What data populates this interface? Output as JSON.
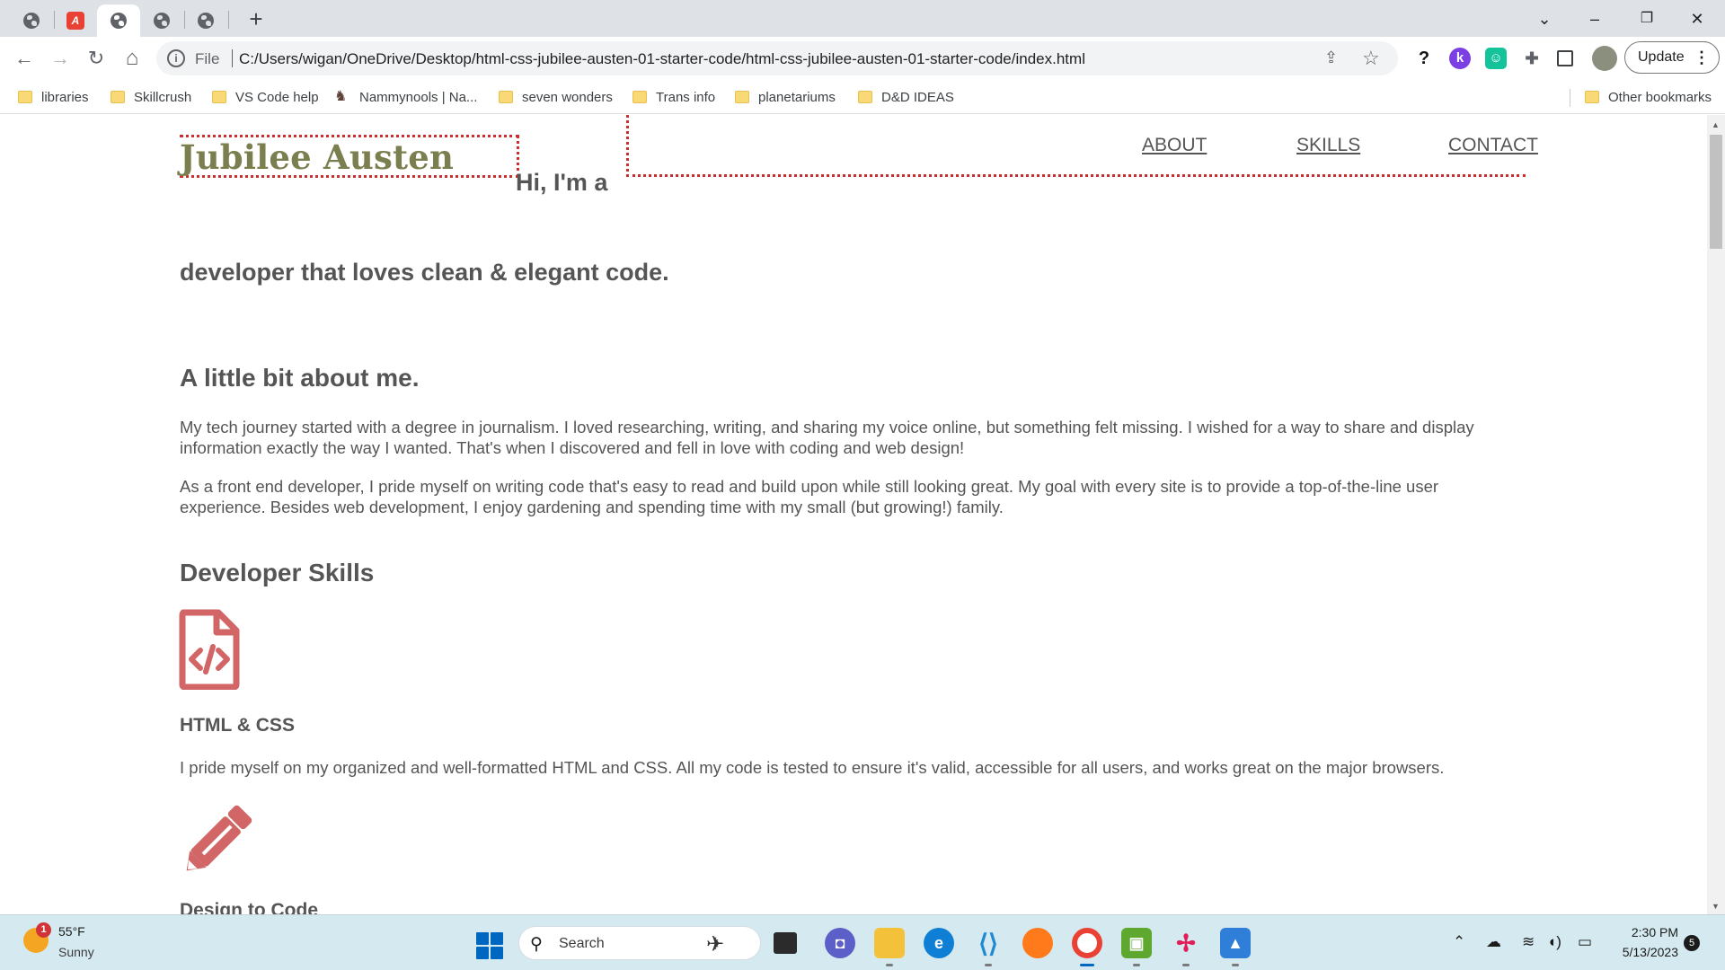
{
  "browser": {
    "tabs": [
      {
        "icon": "globe-icon"
      },
      {
        "icon": "pdf-icon"
      },
      {
        "icon": "globe-icon",
        "active": true
      },
      {
        "icon": "globe-icon"
      },
      {
        "icon": "globe-icon"
      }
    ],
    "new_tab": "+",
    "window_controls": {
      "minimize": "–",
      "restore": "❐",
      "close": "✕",
      "tab_search": "⌄"
    },
    "nav": {
      "back": "←",
      "forward": "→",
      "reload": "↻",
      "home": "⌂"
    },
    "address": {
      "scheme": "File",
      "url": "C:/Users/wigan/OneDrive/Desktop/html-css-jubilee-austen-01-starter-code/html-css-jubilee-austen-01-starter-code/index.html"
    },
    "update_label": "Update",
    "bookmarks": [
      "libraries",
      "Skillcrush",
      "VS Code help",
      "Nammynools | Na...",
      "seven wonders",
      "Trans info",
      "planetariums",
      "D&D IDEAS"
    ],
    "other_bookmarks": "Other bookmarks"
  },
  "site": {
    "logo": "Jubilee Austen",
    "nav": [
      "ABOUT",
      "SKILLS",
      "CONTACT"
    ],
    "hero_intro": "Hi, I'm a",
    "hero_tagline": "developer that loves clean & elegant code.",
    "about": {
      "heading": "A little bit about me.",
      "paragraphs": [
        "My tech journey started with a degree in journalism. I loved researching, writing, and sharing my voice online, but something felt missing. I wished for a way to share and display information exactly the way I wanted. That's when I discovered and fell in love with coding and web design!",
        "As a front end developer, I pride myself on writing code that's easy to read and build upon while still looking great. My goal with every site is to provide a top-of-the-line user experience. Besides web development, I enjoy gardening and spending time with my small (but growing!) family."
      ]
    },
    "skills": {
      "heading": "Developer Skills",
      "items": [
        {
          "icon": "code-file-icon",
          "title": "HTML & CSS",
          "desc": "I pride myself on my organized and well-formatted HTML and CSS. All my code is tested to ensure it's valid, accessible for all users, and works great on the major browsers."
        },
        {
          "icon": "pencil-icon",
          "title": "Design to Code"
        }
      ]
    },
    "accent_color": "#cc2d2d",
    "icon_color": "#d26565",
    "logo_color": "#7b7f4f"
  },
  "taskbar": {
    "weather": {
      "temp": "55°F",
      "condition": "Sunny",
      "alerts": "1"
    },
    "search_label": "Search",
    "time": "2:30 PM",
    "date": "5/13/2023",
    "notifications": "5"
  }
}
